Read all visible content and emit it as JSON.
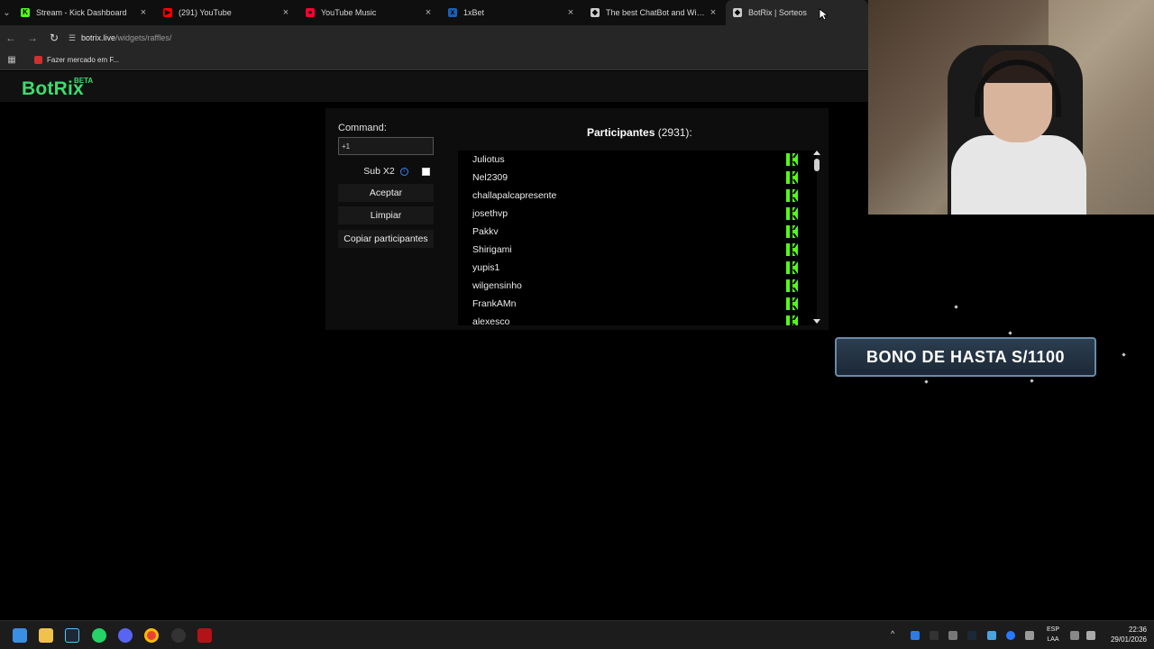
{
  "browser": {
    "tabs": [
      {
        "label": "Stream - Kick Dashboard",
        "favicon": "kick-icon",
        "color": "#53fc18",
        "glyph": "K"
      },
      {
        "label": "(291) YouTube",
        "favicon": "youtube-icon",
        "color": "#ff0000",
        "glyph": "▶"
      },
      {
        "label": "YouTube Music",
        "favicon": "youtube-music-icon",
        "color": "#ff0033",
        "glyph": "●"
      },
      {
        "label": "1xBet",
        "favicon": "1xbet-icon",
        "color": "#1a5fb4",
        "glyph": "x"
      },
      {
        "label": "The best ChatBot and Widgets",
        "favicon": "botrix-icon",
        "color": "#cccccc",
        "glyph": "◆"
      },
      {
        "label": "BotRix | Sorteos",
        "favicon": "botrix-icon",
        "color": "#cccccc",
        "glyph": "◆",
        "active": true
      }
    ],
    "url_host": "botrix.live",
    "url_path": "/widgets/raffles/",
    "bookmark": "Fazer mercado em F..."
  },
  "site": {
    "logo": "BotRix",
    "badge": "BETA",
    "accent": "#3ddc6e"
  },
  "raffle": {
    "command_label": "Command:",
    "command_value": "+1",
    "sub_label": "Sub X2",
    "accept": "Aceptar",
    "clear": "Limpiar",
    "copy": "Copiar participantes",
    "participants_label": "Participantes",
    "participants_count": "(2931)",
    "participants_suffix": ":",
    "participants": [
      "Juliotus",
      "Nel2309",
      "challapalcapresente",
      "josethvp",
      "Pakkv",
      "Shirigami",
      "yupis1",
      "wilgensinho",
      "FrankAMn",
      "alexesco"
    ]
  },
  "overlay": {
    "banner": "BONO DE HASTA S/1100"
  },
  "taskbar": {
    "lang_line1": "ESP",
    "lang_line2": "LAA",
    "time": "22:36",
    "date": "29/01/2026"
  }
}
